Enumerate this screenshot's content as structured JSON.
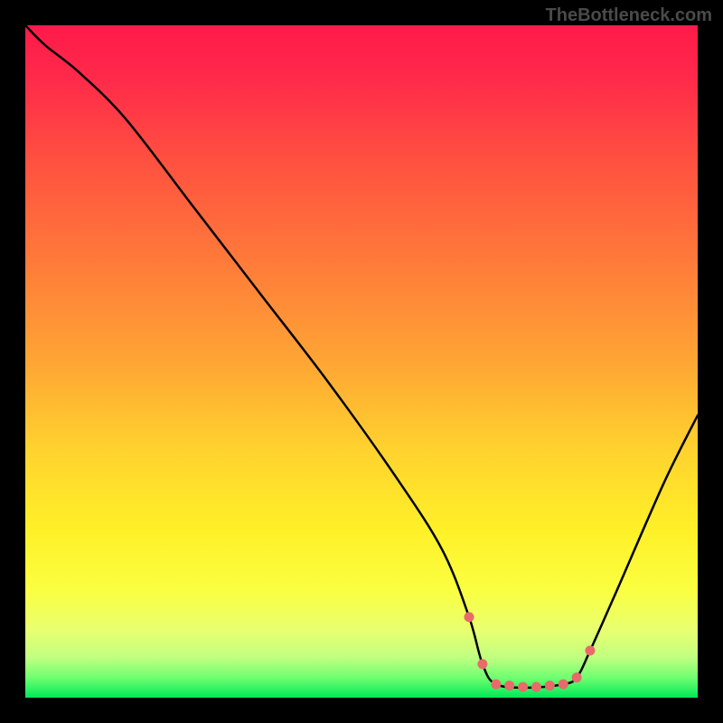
{
  "watermark": "TheBottleneck.com",
  "chart_data": {
    "type": "line",
    "title": "",
    "xlabel": "",
    "ylabel": "",
    "xlim": [
      0,
      100
    ],
    "ylim": [
      0,
      100
    ],
    "description": "Bottleneck curve over a heatmap gradient background. Curve descends steeply from top-left, reaches a flat minimum (optimal zone) around x 68-82, then rises toward the right edge. Background gradient runs red (top, high bottleneck) through orange and yellow to green (bottom, low bottleneck). Pink dotted markers highlight the minimum flat region.",
    "series": [
      {
        "name": "bottleneck-curve",
        "x": [
          0,
          3,
          8,
          15,
          25,
          35,
          45,
          55,
          62,
          66,
          68,
          70,
          75,
          80,
          82,
          84,
          88,
          95,
          100
        ],
        "values": [
          100,
          97,
          93,
          86,
          73,
          60,
          47,
          33,
          22,
          12,
          5,
          2,
          1.5,
          2,
          3,
          7,
          16,
          32,
          42
        ]
      }
    ],
    "optimal_markers_x": [
      66,
      68,
      70,
      72,
      74,
      76,
      78,
      80,
      82,
      84
    ],
    "gradient_stops": [
      {
        "offset": 0.0,
        "color": "#ff1a4a"
      },
      {
        "offset": 0.08,
        "color": "#ff2a4a"
      },
      {
        "offset": 0.2,
        "color": "#ff5040"
      },
      {
        "offset": 0.35,
        "color": "#ff7a3a"
      },
      {
        "offset": 0.5,
        "color": "#ffa534"
      },
      {
        "offset": 0.63,
        "color": "#ffd22e"
      },
      {
        "offset": 0.75,
        "color": "#fff028"
      },
      {
        "offset": 0.84,
        "color": "#faff40"
      },
      {
        "offset": 0.9,
        "color": "#e8ff70"
      },
      {
        "offset": 0.94,
        "color": "#c0ff80"
      },
      {
        "offset": 0.97,
        "color": "#70ff70"
      },
      {
        "offset": 1.0,
        "color": "#00e858"
      }
    ]
  }
}
